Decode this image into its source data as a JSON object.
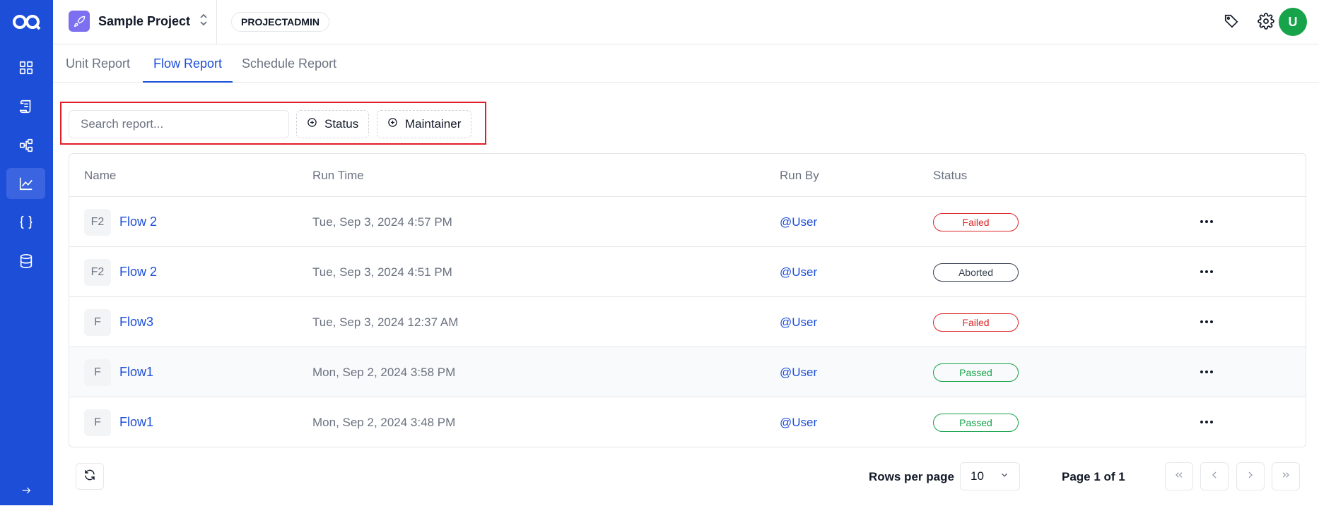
{
  "app": {
    "logo_icon": "aq-logo-icon",
    "project_name": "Sample Project",
    "role_badge": "PROJECTADMIN",
    "avatar_initial": "U",
    "accent_color": "#1d4ed8"
  },
  "sidebar": {
    "items": [
      {
        "icon": "dashboard-grid-icon"
      },
      {
        "icon": "scroll-icon"
      },
      {
        "icon": "flow-icon"
      },
      {
        "icon": "chart-icon",
        "active": true
      },
      {
        "icon": "braces-icon"
      },
      {
        "icon": "database-icon"
      }
    ],
    "expand_icon": "arrow-right-icon"
  },
  "tabs": [
    {
      "label": "Unit Report"
    },
    {
      "label": "Flow Report",
      "active": true
    },
    {
      "label": "Schedule Report"
    }
  ],
  "filters": {
    "search_placeholder": "Search report...",
    "status_label": "Status",
    "maintainer_label": "Maintainer"
  },
  "table": {
    "headers": {
      "name": "Name",
      "run_time": "Run Time",
      "run_by": "Run By",
      "status": "Status"
    },
    "rows": [
      {
        "initials": "F2",
        "name": "Flow 2",
        "run_time": "Tue, Sep 3, 2024 4:57 PM",
        "run_by": "@User",
        "status": "Failed"
      },
      {
        "initials": "F2",
        "name": "Flow 2",
        "run_time": "Tue, Sep 3, 2024 4:51 PM",
        "run_by": "@User",
        "status": "Aborted"
      },
      {
        "initials": "F",
        "name": "Flow3",
        "run_time": "Tue, Sep 3, 2024 12:37 AM",
        "run_by": "@User",
        "status": "Failed"
      },
      {
        "initials": "F",
        "name": "Flow1",
        "run_time": "Mon, Sep 2, 2024 3:58 PM",
        "run_by": "@User",
        "status": "Passed"
      },
      {
        "initials": "F",
        "name": "Flow1",
        "run_time": "Mon, Sep 2, 2024 3:48 PM",
        "run_by": "@User",
        "status": "Passed"
      }
    ]
  },
  "pagination": {
    "rows_per_page_label": "Rows per page",
    "rows_per_page_value": "10",
    "page_text": "Page 1 of  1"
  }
}
